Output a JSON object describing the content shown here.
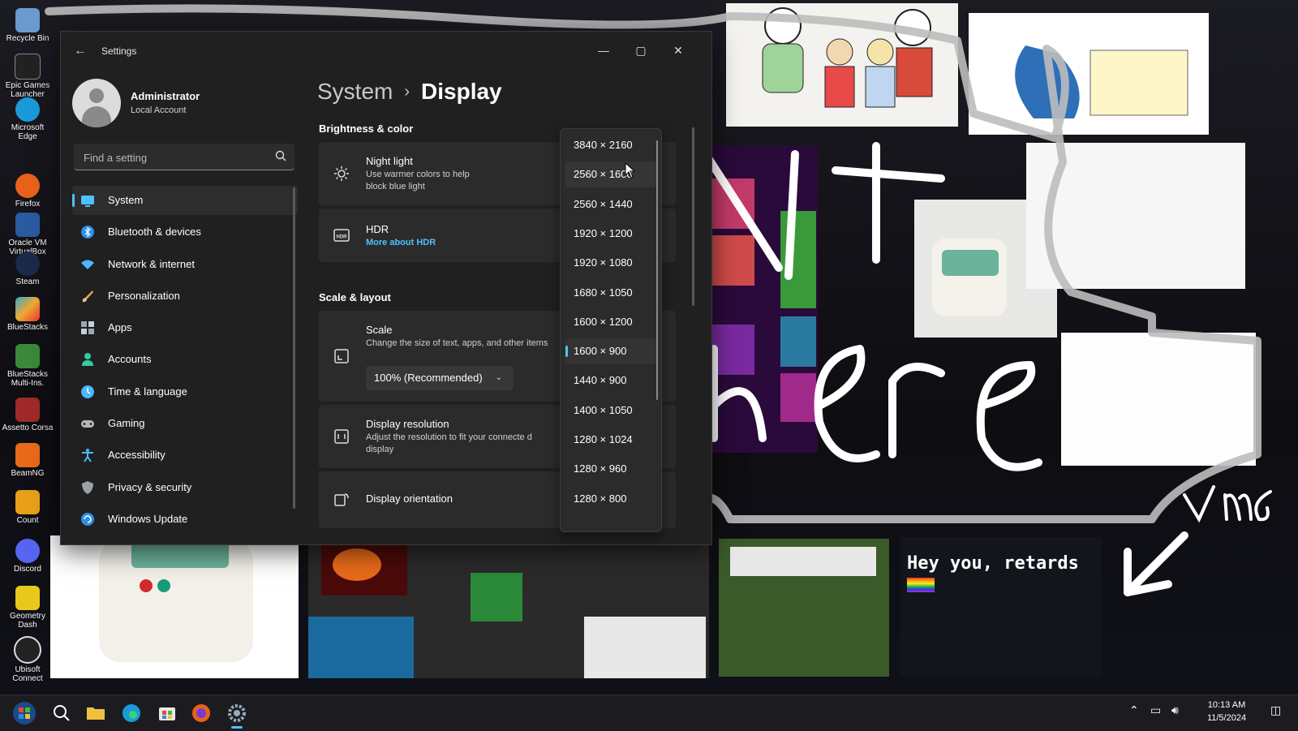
{
  "window": {
    "title": "Settings"
  },
  "user": {
    "name": "Administrator",
    "account_type": "Local Account"
  },
  "search": {
    "placeholder": "Find a setting"
  },
  "nav": {
    "items": [
      {
        "label": "System",
        "icon": "system-icon",
        "color": "#4cc2ff",
        "active": true
      },
      {
        "label": "Bluetooth & devices",
        "icon": "bluetooth-icon",
        "color": "#2e8fe6"
      },
      {
        "label": "Network & internet",
        "icon": "wifi-icon",
        "color": "#4cb8ff"
      },
      {
        "label": "Personalization",
        "icon": "brush-icon",
        "color": "#e8a35a"
      },
      {
        "label": "Apps",
        "icon": "apps-icon",
        "color": "#9aa7b8"
      },
      {
        "label": "Accounts",
        "icon": "person-icon",
        "color": "#38c7a0"
      },
      {
        "label": "Time & language",
        "icon": "globe-clock-icon",
        "color": "#4cb8ff"
      },
      {
        "label": "Gaming",
        "icon": "controller-icon",
        "color": "#b8b8b8"
      },
      {
        "label": "Accessibility",
        "icon": "accessibility-icon",
        "color": "#4cb8ff"
      },
      {
        "label": "Privacy & security",
        "icon": "shield-icon",
        "color": "#9aa0a8"
      },
      {
        "label": "Windows Update",
        "icon": "update-icon",
        "color": "#2e8fe6"
      }
    ]
  },
  "breadcrumb": {
    "parent": "System",
    "separator": "›",
    "current": "Display"
  },
  "brightness": {
    "section_title": "Brightness & color",
    "night_light": {
      "title": "Night light",
      "desc": "Use warmer colors to help block blue light"
    },
    "hdr": {
      "title": "HDR",
      "link": "More about HDR"
    }
  },
  "scale_layout": {
    "section_title": "Scale & layout",
    "scale": {
      "title": "Scale",
      "desc": "Change the size of text, apps, and other items",
      "value": "100% (Recommended)"
    },
    "resolution": {
      "title": "Display resolution",
      "desc": "Adjust the resolution to fit your connecte d display"
    },
    "orientation": {
      "title": "Display orientation"
    }
  },
  "resolution_dropdown": {
    "options": [
      "3840 × 2160",
      "2560 × 1600",
      "2560 × 1440",
      "1920 × 1200",
      "1920 × 1080",
      "1680 × 1050",
      "1600 × 1200",
      "1600 × 900",
      "1440 × 900",
      "1400 × 1050",
      "1280 × 1024",
      "1280 × 960",
      "1280 × 800"
    ],
    "selected": "1600 × 900",
    "hovered": "2560 × 1600"
  },
  "desktop": {
    "icons": [
      "Recycle Bin",
      "Epic Games Launcher",
      "Microsoft Edge",
      "Firefox",
      "Oracle VM VirtualBox",
      "Steam",
      "BlueStacks",
      "BlueStacks Multi-Ins.",
      "Assetto Corsa",
      "BeamNG",
      "Count",
      "Discord",
      "Geometry Dash",
      "Ubisoft Connect"
    ],
    "scribble_text": [
      "Kit",
      "here",
      "VM6"
    ],
    "meme_text": "Hey you, retards"
  },
  "taskbar": {
    "items": [
      "start-icon",
      "search-icon",
      "file-explorer-icon",
      "edge-icon",
      "store-icon",
      "firefox-icon",
      "settings-icon"
    ],
    "time": "10:13 AM",
    "date": "11/5/2024"
  },
  "colors": {
    "accent": "#4cc2ff",
    "window_bg": "#202020",
    "card_bg": "#2b2b2b"
  }
}
